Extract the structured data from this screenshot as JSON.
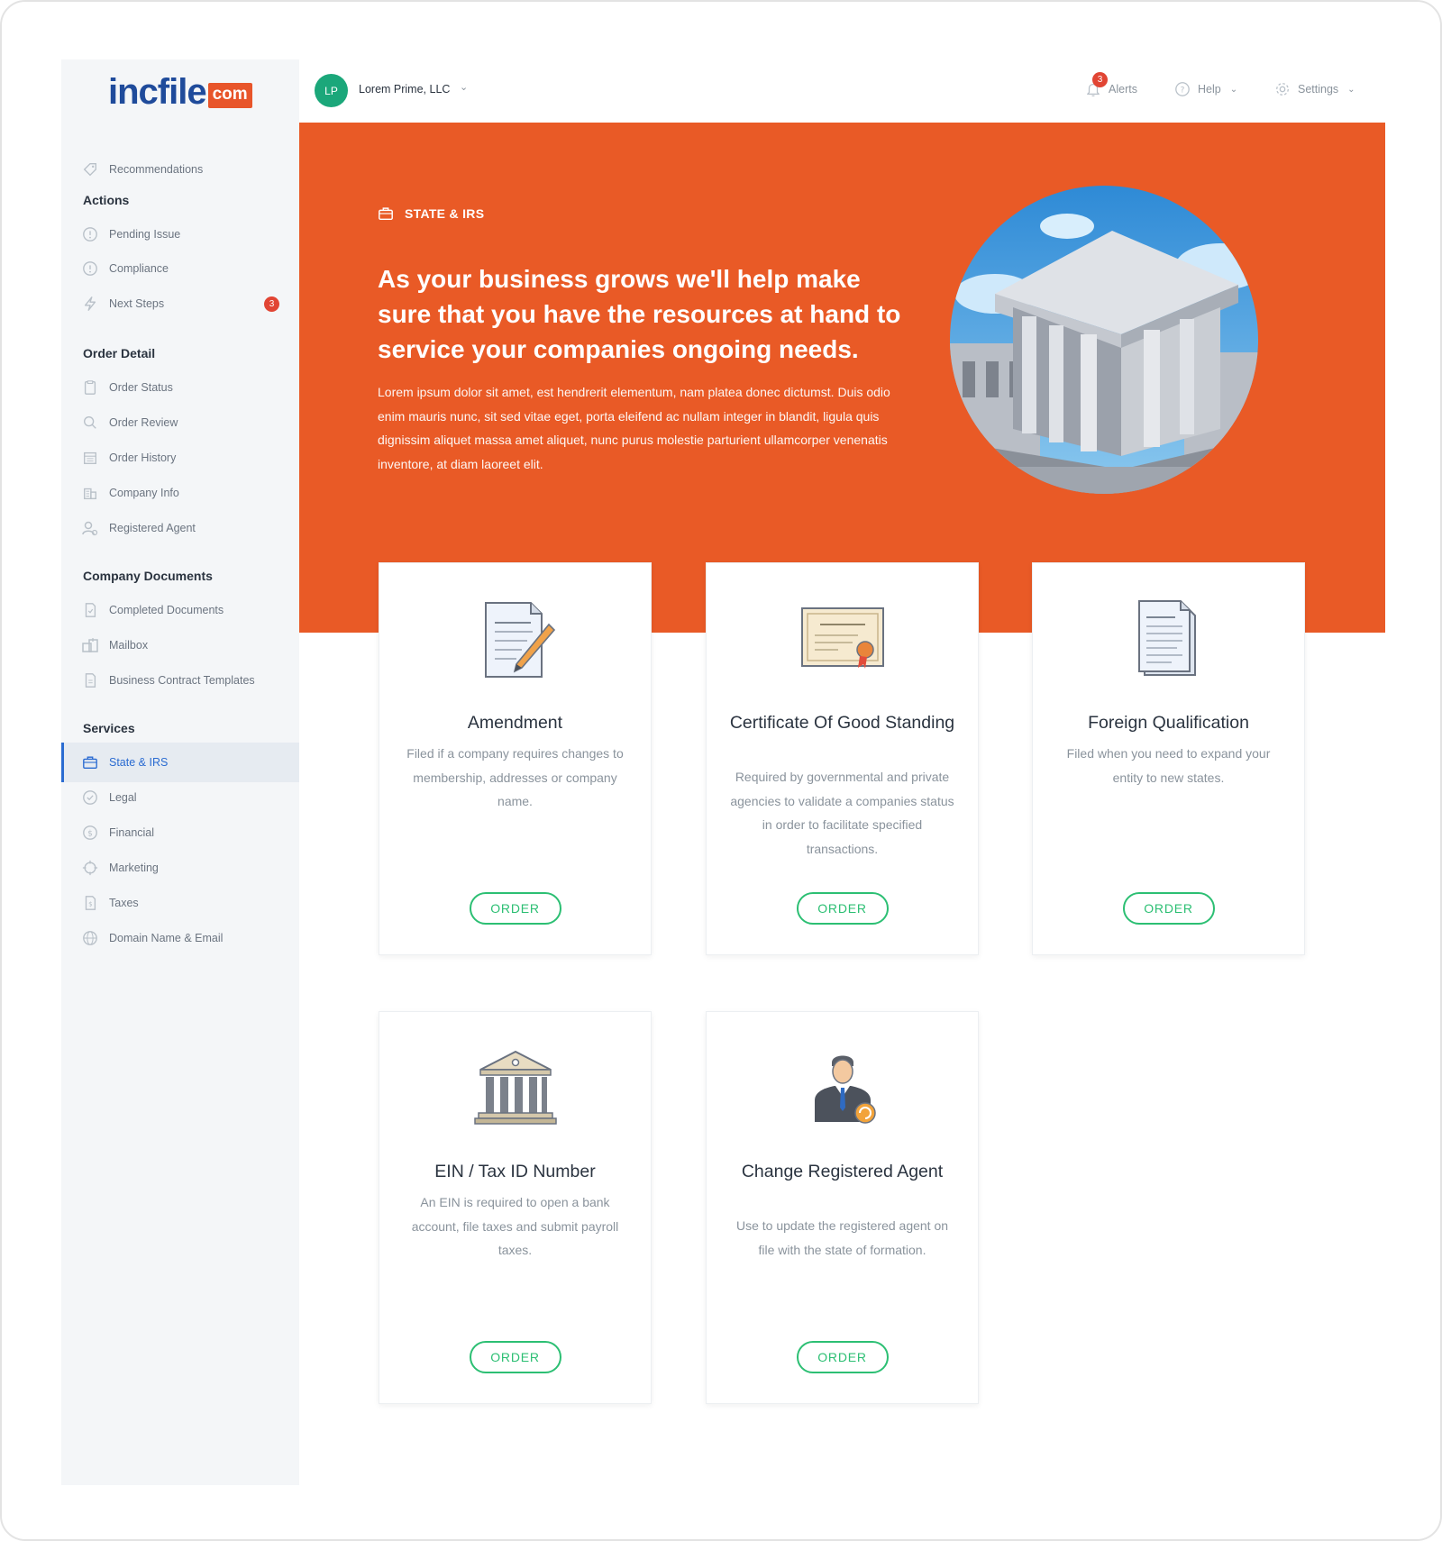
{
  "logo": {
    "main": "incfile",
    "suffix": "com"
  },
  "sidebar": {
    "recommendations": "Recommendations",
    "actions": {
      "heading": "Actions",
      "items": [
        {
          "label": "Pending Issue"
        },
        {
          "label": "Compliance"
        },
        {
          "label": "Next Steps",
          "badge": "3"
        }
      ]
    },
    "order_detail": {
      "heading": "Order Detail",
      "items": [
        {
          "label": "Order Status"
        },
        {
          "label": "Order Review"
        },
        {
          "label": "Order History"
        },
        {
          "label": "Company Info"
        },
        {
          "label": "Registered Agent"
        }
      ]
    },
    "company_documents": {
      "heading": "Company Documents",
      "items": [
        {
          "label": "Completed Documents"
        },
        {
          "label": "Mailbox"
        },
        {
          "label": "Business Contract Templates"
        }
      ]
    },
    "services": {
      "heading": "Services",
      "items": [
        {
          "label": "State & IRS",
          "active": true
        },
        {
          "label": "Legal"
        },
        {
          "label": "Financial"
        },
        {
          "label": "Marketing"
        },
        {
          "label": "Taxes"
        },
        {
          "label": "Domain Name & Email"
        }
      ]
    }
  },
  "topbar": {
    "avatar_initials": "LP",
    "company_name": "Lorem Prime, LLC",
    "alerts_label": "Alerts",
    "alerts_count": "3",
    "help_label": "Help",
    "settings_label": "Settings"
  },
  "hero": {
    "eyebrow": "STATE & IRS",
    "title": "As your business grows we'll help make sure that you have the resources at hand to service your companies ongoing needs.",
    "body": "Lorem ipsum dolor sit amet, est hendrerit elementum, nam platea donec dictumst. Duis odio enim mauris nunc, sit sed vitae eget, porta eleifend ac nullam integer in blandit, ligula quis dignissim aliquet massa amet aliquet, nunc purus molestie parturient ullamcorper venenatis inventore, at diam laoreet elit."
  },
  "cards": [
    {
      "icon": "document-pencil-icon",
      "title": "Amendment",
      "description": "Filed if a company requires changes to membership, addresses or company name.",
      "button": "ORDER"
    },
    {
      "icon": "certificate-icon",
      "title": "Certificate Of Good Standing",
      "description": "Required by governmental and private agencies to validate a companies status in order to facilitate specified transactions.",
      "button": "ORDER"
    },
    {
      "icon": "documents-icon",
      "title": "Foreign Qualification",
      "description": "Filed when you need to expand your entity to new states.",
      "button": "ORDER"
    },
    {
      "icon": "bank-building-icon",
      "title": "EIN / Tax ID Number",
      "description": "An EIN is required to open a bank account, file taxes and submit payroll taxes.",
      "button": "ORDER"
    },
    {
      "icon": "agent-person-icon",
      "title": "Change Registered Agent",
      "description": "Use to update the registered agent on file with the state of formation.",
      "button": "ORDER"
    }
  ],
  "colors": {
    "brand_orange": "#e95a26",
    "brand_blue": "#1f4b9b",
    "accent_green": "#2cbf73",
    "active_blue": "#2a6bd1",
    "badge_red": "#e14534",
    "avatar_green": "#1ba77a"
  }
}
